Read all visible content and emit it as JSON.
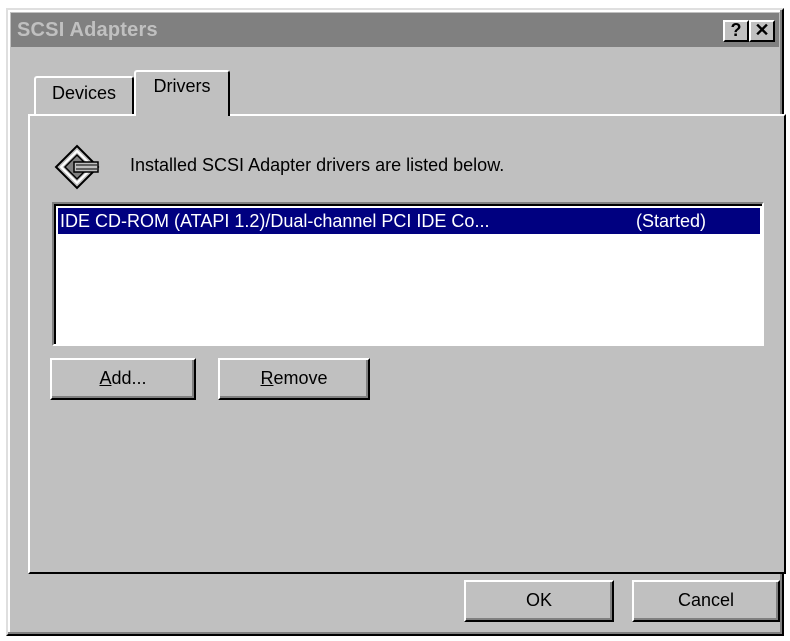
{
  "window": {
    "title": "SCSI Adapters",
    "help_label": "?",
    "close_label": "✕"
  },
  "tabs": [
    {
      "label": "Devices",
      "selected": false
    },
    {
      "label": "Drivers",
      "selected": true
    }
  ],
  "drivers_panel": {
    "info_text": "Installed SCSI Adapter drivers are listed below.",
    "icon": "scsi-adapter-icon",
    "list": [
      {
        "name": "IDE CD-ROM (ATAPI 1.2)/Dual-channel PCI IDE Co...",
        "status": "(Started)",
        "selected": true
      }
    ],
    "add_button": {
      "mnemonic": "A",
      "rest": "dd..."
    },
    "remove_button": {
      "mnemonic": "R",
      "rest": "emove"
    }
  },
  "footer": {
    "ok_label": "OK",
    "cancel_label": "Cancel"
  },
  "colors": {
    "face": "#c0c0c0",
    "selection": "#000080",
    "title_inactive": "#808080"
  }
}
